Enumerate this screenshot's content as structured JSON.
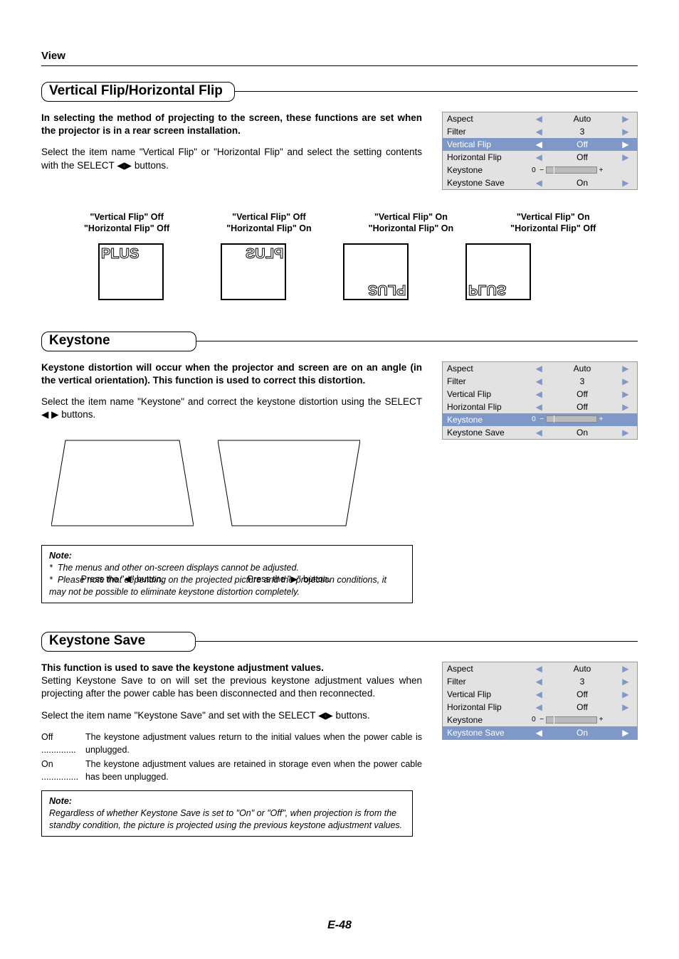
{
  "header": {
    "view": "View"
  },
  "sections": {
    "flip": {
      "title": "Vertical Flip/Horizontal Flip",
      "intro_bold": "In selecting the method of projecting to the screen, these functions are set when the projector is in a rear screen installation.",
      "intro_body": "Select the item name \"Vertical Flip\" or \"Horizontal Flip\" and select the setting contents with the SELECT ◀▶ buttons.",
      "examples": [
        {
          "l1": "\"Vertical Flip\" Off",
          "l2": "\"Horizontal Flip\" Off"
        },
        {
          "l1": "\"Vertical Flip\" Off",
          "l2": "\"Horizontal Flip\" On"
        },
        {
          "l1": "\"Vertical Flip\" On",
          "l2": "\"Horizontal Flip\" On"
        },
        {
          "l1": "\"Vertical Flip\" On",
          "l2": "\"Horizontal Flip\" Off"
        }
      ],
      "logo": "PLUS"
    },
    "keystone": {
      "title": "Keystone",
      "intro_bold": "Keystone distortion will occur when the projector and screen are on an angle (in the vertical orientation). This function is used to correct this distortion.",
      "intro_body": "Select the item name \"Keystone\" and correct the keystone distortion using the SELECT ◀ ▶ buttons.",
      "press_left": "Press the \"◀\" button.",
      "press_right": "Press the \"▶\" button.",
      "note_label": "Note:",
      "note1": "The menus and other on-screen displays cannot be adjusted.",
      "note2": "Please note that depending on the projected picture and the projection conditions, it may not be possible to eliminate keystone distortion completely."
    },
    "save": {
      "title": "Keystone Save",
      "intro_bold": "This function is used to save the keystone adjustment values.",
      "intro_body": "Setting Keystone Save to on will set the previous keystone adjustment values when projecting after the power cable has been disconnected and then reconnected.",
      "select_text": "Select the item name \"Keystone Save\" and set with the SELECT ◀▶ buttons.",
      "off_label": "Off ..............",
      "off_text": "The keystone adjustment values return to the initial values when the power cable is unplugged.",
      "on_label": "On ...............",
      "on_text": "The keystone adjustment values are retained in storage even when the power cable has been unplugged.",
      "note_label": "Note:",
      "note": "Regardless of whether Keystone Save is set to \"On\" or \"Off\", when projection is from the standby condition, the picture is projected using the previous keystone adjustment values."
    }
  },
  "menu": {
    "rows": [
      {
        "name": "Aspect",
        "value": "Auto",
        "type": "sel"
      },
      {
        "name": "Filter",
        "value": "3",
        "type": "sel"
      },
      {
        "name": "Vertical Flip",
        "value": "Off",
        "type": "sel"
      },
      {
        "name": "Horizontal Flip",
        "value": "Off",
        "type": "sel"
      },
      {
        "name": "Keystone",
        "value": "",
        "type": "slider",
        "num": "0"
      },
      {
        "name": "Keystone Save",
        "value": "On",
        "type": "sel"
      }
    ]
  },
  "page_num": "E-48"
}
